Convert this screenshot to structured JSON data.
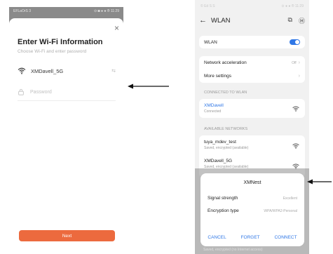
{
  "left_screen": {
    "status_left": "EFLaOrS 3",
    "status_right": "⊙ ◙ ● ● ® 11:29",
    "close_glyph": "×",
    "title": "Enter Wi-Fi Information",
    "subtitle": "Choose Wi-Fi and enter password",
    "wifi_ssid": "XMDavell_5G",
    "wifi_icon": "wifi-icon",
    "swap_glyph": "⇆",
    "password_placeholder": "Password",
    "lock_icon": "lock-icon",
    "next_label": "Next",
    "accent_color": "#ec6a3e"
  },
  "right_screen": {
    "status_left": "© Ed S S",
    "status_right": "⊙ ● ● ® 11:29",
    "back_glyph": "←",
    "title": "WLAN",
    "scan_glyph": "⧉",
    "help_glyph": "Ⓗ",
    "wlan_label": "WLAN",
    "wlan_on": true,
    "network_acceleration_label": "Network acceleration",
    "network_acceleration_value": "Off",
    "more_settings_label": "More settings",
    "connected_section_label": "CONNECTED TO WLAN",
    "connected_network": {
      "name": "XMDavell",
      "status": "Connected"
    },
    "available_section_label": "AVAILABLE NETWORKS",
    "available_networks": [
      {
        "name": "tuya_mdev_test",
        "status": "Saved, encrypted (available)"
      },
      {
        "name": "XMDavell_5G",
        "status": "Saved, encrypted (available)"
      }
    ],
    "bottom_peek_text": "Saved, encrypted (no Internet access)",
    "accent_color": "#2f77e6"
  },
  "dialog": {
    "title": "XMNest",
    "signal_label": "Signal strength",
    "signal_value": "Excellent",
    "encryption_label": "Encryption type",
    "encryption_value": "WPA/WPA2-Personal",
    "cancel_label": "CANCEL",
    "forget_label": "FORGET",
    "connect_label": "CONNECT"
  }
}
